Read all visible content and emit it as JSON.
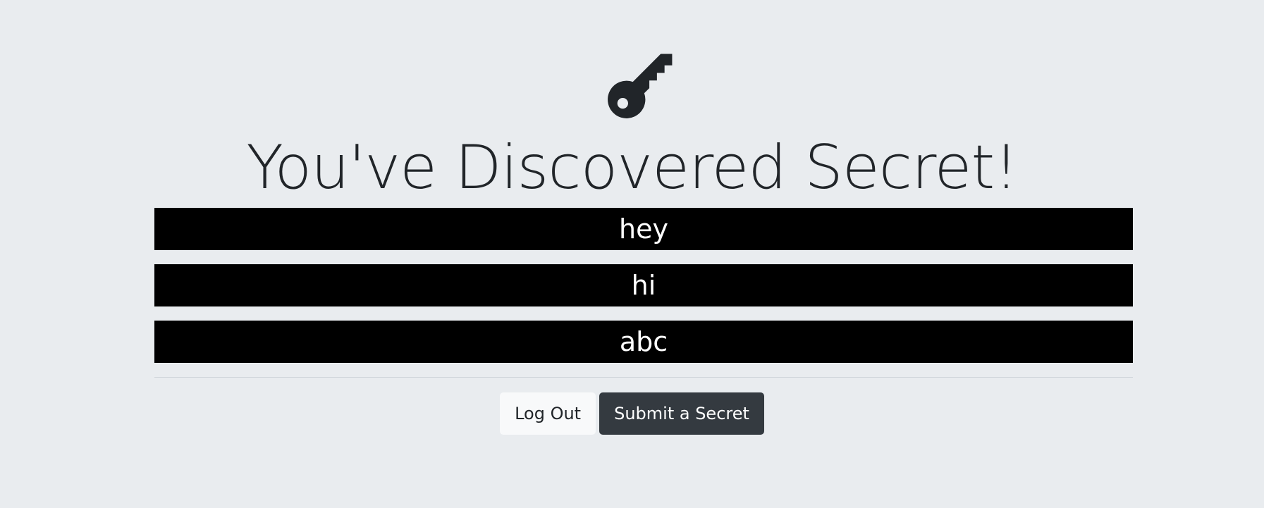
{
  "header": {
    "icon": "key-icon",
    "title": "You've Discovered Secret!"
  },
  "secrets": [
    "hey",
    "hi",
    "abc"
  ],
  "actions": {
    "logout_label": "Log Out",
    "submit_label": "Submit a Secret"
  },
  "colors": {
    "page_background": "#e9ecef",
    "secret_background": "#000000",
    "secret_text": "#ffffff",
    "icon_and_title": "#212529",
    "logout_button": "#f8f9fa",
    "submit_button": "#343a40"
  }
}
